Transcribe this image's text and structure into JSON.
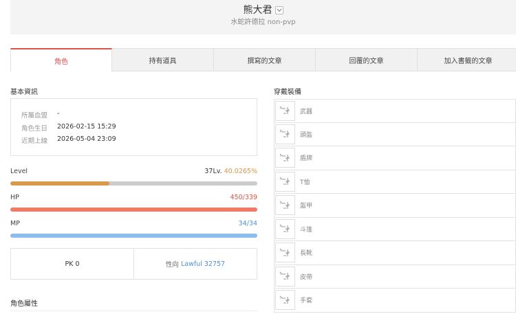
{
  "header": {
    "character_name": "熊大君",
    "server_info": "水蛇許德拉 non-pvp"
  },
  "tabs": [
    {
      "label": "角色",
      "active": true
    },
    {
      "label": "持有道具",
      "active": false
    },
    {
      "label": "撰寫的文章",
      "active": false
    },
    {
      "label": "回覆的文章",
      "active": false
    },
    {
      "label": "加入書籤的文章",
      "active": false
    }
  ],
  "basic_info": {
    "title": "基本資訊",
    "rows": [
      {
        "label": "所屬血盟",
        "value": "-"
      },
      {
        "label": "角色生日",
        "value": "2026-02-15 15:29"
      },
      {
        "label": "近期上線",
        "value": "2026-05-04 23:09"
      }
    ]
  },
  "stats": {
    "level": {
      "label": "Level",
      "level_text": "37Lv.",
      "percent_text": "40.0265%",
      "fraction": 0.400265,
      "color": "#d99a4e",
      "percent_color": "#d9964a"
    },
    "hp": {
      "label": "HP",
      "value_text": "450/339",
      "fraction": 1.0,
      "color": "#ef7a66",
      "value_color": "#e0533f"
    },
    "mp": {
      "label": "MP",
      "value_text": "34/34",
      "fraction": 1.0,
      "color": "#8fbcee",
      "value_color": "#4a90d9"
    }
  },
  "pk": {
    "pk_label": "PK",
    "pk_value": "0",
    "alignment_label": "性向",
    "alignment_value": "Lawful 32757",
    "alignment_color": "#4a90d9"
  },
  "attributes": {
    "title": "角色屬性"
  },
  "equipment": {
    "title": "穿戴裝備",
    "slots": [
      {
        "label": "武器",
        "icon": "empty-slot-icon"
      },
      {
        "label": "頭盔",
        "icon": "empty-slot-icon"
      },
      {
        "label": "盾牌",
        "icon": "empty-slot-icon"
      },
      {
        "label": "T恤",
        "icon": "empty-slot-icon"
      },
      {
        "label": "盔甲",
        "icon": "empty-slot-icon"
      },
      {
        "label": "斗篷",
        "icon": "empty-slot-icon"
      },
      {
        "label": "長靴",
        "icon": "empty-slot-icon"
      },
      {
        "label": "皮帶",
        "icon": "empty-slot-icon"
      },
      {
        "label": "手套",
        "icon": "empty-slot-icon"
      }
    ]
  }
}
